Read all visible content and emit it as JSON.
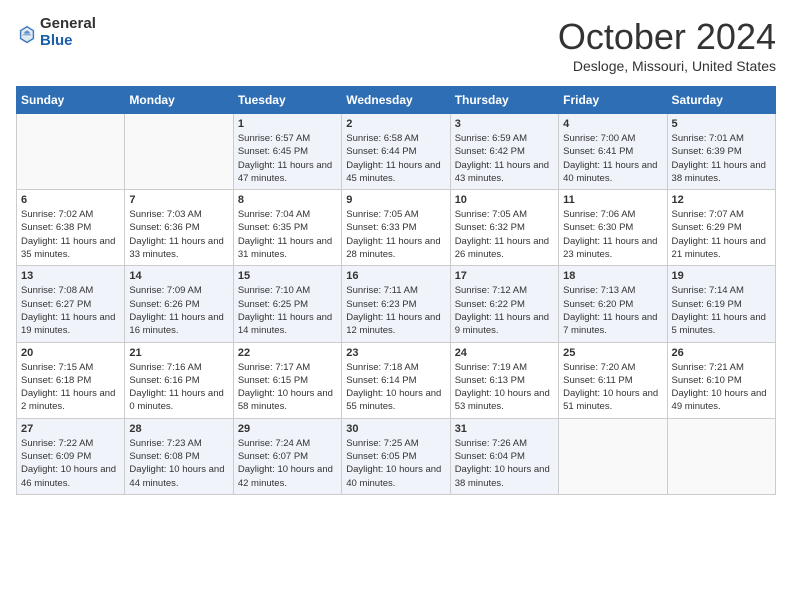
{
  "header": {
    "logo_line1": "General",
    "logo_line2": "Blue",
    "month_title": "October 2024",
    "location": "Desloge, Missouri, United States"
  },
  "days_of_week": [
    "Sunday",
    "Monday",
    "Tuesday",
    "Wednesday",
    "Thursday",
    "Friday",
    "Saturday"
  ],
  "weeks": [
    [
      {
        "day": "",
        "info": ""
      },
      {
        "day": "",
        "info": ""
      },
      {
        "day": "1",
        "info": "Sunrise: 6:57 AM\nSunset: 6:45 PM\nDaylight: 11 hours and 47 minutes."
      },
      {
        "day": "2",
        "info": "Sunrise: 6:58 AM\nSunset: 6:44 PM\nDaylight: 11 hours and 45 minutes."
      },
      {
        "day": "3",
        "info": "Sunrise: 6:59 AM\nSunset: 6:42 PM\nDaylight: 11 hours and 43 minutes."
      },
      {
        "day": "4",
        "info": "Sunrise: 7:00 AM\nSunset: 6:41 PM\nDaylight: 11 hours and 40 minutes."
      },
      {
        "day": "5",
        "info": "Sunrise: 7:01 AM\nSunset: 6:39 PM\nDaylight: 11 hours and 38 minutes."
      }
    ],
    [
      {
        "day": "6",
        "info": "Sunrise: 7:02 AM\nSunset: 6:38 PM\nDaylight: 11 hours and 35 minutes."
      },
      {
        "day": "7",
        "info": "Sunrise: 7:03 AM\nSunset: 6:36 PM\nDaylight: 11 hours and 33 minutes."
      },
      {
        "day": "8",
        "info": "Sunrise: 7:04 AM\nSunset: 6:35 PM\nDaylight: 11 hours and 31 minutes."
      },
      {
        "day": "9",
        "info": "Sunrise: 7:05 AM\nSunset: 6:33 PM\nDaylight: 11 hours and 28 minutes."
      },
      {
        "day": "10",
        "info": "Sunrise: 7:05 AM\nSunset: 6:32 PM\nDaylight: 11 hours and 26 minutes."
      },
      {
        "day": "11",
        "info": "Sunrise: 7:06 AM\nSunset: 6:30 PM\nDaylight: 11 hours and 23 minutes."
      },
      {
        "day": "12",
        "info": "Sunrise: 7:07 AM\nSunset: 6:29 PM\nDaylight: 11 hours and 21 minutes."
      }
    ],
    [
      {
        "day": "13",
        "info": "Sunrise: 7:08 AM\nSunset: 6:27 PM\nDaylight: 11 hours and 19 minutes."
      },
      {
        "day": "14",
        "info": "Sunrise: 7:09 AM\nSunset: 6:26 PM\nDaylight: 11 hours and 16 minutes."
      },
      {
        "day": "15",
        "info": "Sunrise: 7:10 AM\nSunset: 6:25 PM\nDaylight: 11 hours and 14 minutes."
      },
      {
        "day": "16",
        "info": "Sunrise: 7:11 AM\nSunset: 6:23 PM\nDaylight: 11 hours and 12 minutes."
      },
      {
        "day": "17",
        "info": "Sunrise: 7:12 AM\nSunset: 6:22 PM\nDaylight: 11 hours and 9 minutes."
      },
      {
        "day": "18",
        "info": "Sunrise: 7:13 AM\nSunset: 6:20 PM\nDaylight: 11 hours and 7 minutes."
      },
      {
        "day": "19",
        "info": "Sunrise: 7:14 AM\nSunset: 6:19 PM\nDaylight: 11 hours and 5 minutes."
      }
    ],
    [
      {
        "day": "20",
        "info": "Sunrise: 7:15 AM\nSunset: 6:18 PM\nDaylight: 11 hours and 2 minutes."
      },
      {
        "day": "21",
        "info": "Sunrise: 7:16 AM\nSunset: 6:16 PM\nDaylight: 11 hours and 0 minutes."
      },
      {
        "day": "22",
        "info": "Sunrise: 7:17 AM\nSunset: 6:15 PM\nDaylight: 10 hours and 58 minutes."
      },
      {
        "day": "23",
        "info": "Sunrise: 7:18 AM\nSunset: 6:14 PM\nDaylight: 10 hours and 55 minutes."
      },
      {
        "day": "24",
        "info": "Sunrise: 7:19 AM\nSunset: 6:13 PM\nDaylight: 10 hours and 53 minutes."
      },
      {
        "day": "25",
        "info": "Sunrise: 7:20 AM\nSunset: 6:11 PM\nDaylight: 10 hours and 51 minutes."
      },
      {
        "day": "26",
        "info": "Sunrise: 7:21 AM\nSunset: 6:10 PM\nDaylight: 10 hours and 49 minutes."
      }
    ],
    [
      {
        "day": "27",
        "info": "Sunrise: 7:22 AM\nSunset: 6:09 PM\nDaylight: 10 hours and 46 minutes."
      },
      {
        "day": "28",
        "info": "Sunrise: 7:23 AM\nSunset: 6:08 PM\nDaylight: 10 hours and 44 minutes."
      },
      {
        "day": "29",
        "info": "Sunrise: 7:24 AM\nSunset: 6:07 PM\nDaylight: 10 hours and 42 minutes."
      },
      {
        "day": "30",
        "info": "Sunrise: 7:25 AM\nSunset: 6:05 PM\nDaylight: 10 hours and 40 minutes."
      },
      {
        "day": "31",
        "info": "Sunrise: 7:26 AM\nSunset: 6:04 PM\nDaylight: 10 hours and 38 minutes."
      },
      {
        "day": "",
        "info": ""
      },
      {
        "day": "",
        "info": ""
      }
    ]
  ]
}
